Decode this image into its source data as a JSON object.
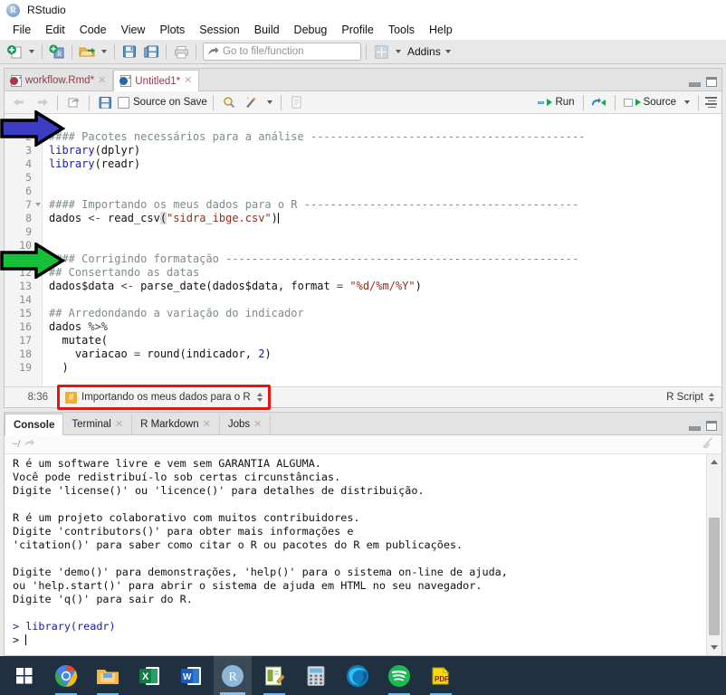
{
  "window": {
    "title": "RStudio",
    "logo_icon": "rstudio-logo-icon"
  },
  "menubar": {
    "items": [
      "File",
      "Edit",
      "Code",
      "View",
      "Plots",
      "Session",
      "Build",
      "Debug",
      "Profile",
      "Tools",
      "Help"
    ]
  },
  "toolbar": {
    "new_file_label": "new-file-icon",
    "new_project_label": "new-project-icon",
    "open_file_label": "open-file-icon",
    "save_label": "save-icon",
    "save_all_label": "save-all-icon",
    "print_label": "print-icon",
    "goto_placeholder": "Go to file/function",
    "workspace_panes_label": "workspace-panes-icon",
    "addins_label": "Addins"
  },
  "source_pane": {
    "tabs": [
      {
        "label": "workflow.Rmd*",
        "icon": "rmarkdown-doc-icon",
        "active": false,
        "closable": true
      },
      {
        "label": "Untitled1*",
        "icon": "rscript-doc-icon",
        "active": true,
        "closable": true
      }
    ],
    "editor_toolbar": {
      "back_label": "back-arrow-icon",
      "forward_label": "forward-arrow-icon",
      "popout_label": "show-in-new-window-icon",
      "save_label": "save-icon",
      "source_on_save_label": "Source on Save",
      "find_label": "find-icon",
      "magic_label": "code-tools-icon",
      "compile_report_label": "compile-report-icon",
      "run_label": "Run",
      "rerun_label": "re-run-icon",
      "source_label": "Source",
      "outline_label": "document-outline-icon"
    },
    "lines": [
      {
        "n": 1,
        "fold": false,
        "segments": []
      },
      {
        "n": 2,
        "fold": false,
        "segments": [
          {
            "t": "#### Pacotes necessários para a análise ------------------------------------------",
            "c": "cmt"
          }
        ]
      },
      {
        "n": 3,
        "fold": false,
        "segments": [
          {
            "t": "library",
            "c": "kw"
          },
          {
            "t": "(dplyr)",
            "c": "plain2"
          }
        ]
      },
      {
        "n": 4,
        "fold": false,
        "segments": [
          {
            "t": "library",
            "c": "kw"
          },
          {
            "t": "(readr)",
            "c": "plain2"
          }
        ]
      },
      {
        "n": 5,
        "fold": false,
        "segments": []
      },
      {
        "n": 6,
        "fold": false,
        "segments": []
      },
      {
        "n": 7,
        "fold": true,
        "segments": [
          {
            "t": "#### Importando os meus dados para o R ------------------------------------------",
            "c": "cmt"
          }
        ]
      },
      {
        "n": 8,
        "fold": false,
        "segments": [
          {
            "t": "dados ",
            "c": "plain2"
          },
          {
            "t": "<- ",
            "c": "op"
          },
          {
            "t": "read_csv",
            "c": "plain2"
          },
          {
            "t": "(",
            "c": "paren-hl"
          },
          {
            "t": "\"sidra_ibge.csv\"",
            "c": "str"
          },
          {
            "t": ")",
            "c": "plain2"
          },
          {
            "t": "|CARET|",
            "c": "caret"
          }
        ]
      },
      {
        "n": 9,
        "fold": false,
        "segments": []
      },
      {
        "n": 10,
        "fold": false,
        "segments": []
      },
      {
        "n": 11,
        "fold": true,
        "segments": [
          {
            "t": "#### Corrigindo formatação ------------------------------------------------------",
            "c": "cmt"
          }
        ]
      },
      {
        "n": 12,
        "fold": false,
        "segments": [
          {
            "t": "## Consertando as datas",
            "c": "cmt"
          }
        ]
      },
      {
        "n": 13,
        "fold": false,
        "segments": [
          {
            "t": "dados$data ",
            "c": "plain2"
          },
          {
            "t": "<- ",
            "c": "op"
          },
          {
            "t": "parse_date(dados$data, format ",
            "c": "plain2"
          },
          {
            "t": "= ",
            "c": "op"
          },
          {
            "t": "\"%d/%m/%Y\"",
            "c": "str"
          },
          {
            "t": ")",
            "c": "plain2"
          }
        ]
      },
      {
        "n": 14,
        "fold": false,
        "segments": []
      },
      {
        "n": 15,
        "fold": false,
        "segments": [
          {
            "t": "## Arredondando a variação do indicador",
            "c": "cmt"
          }
        ]
      },
      {
        "n": 16,
        "fold": false,
        "segments": [
          {
            "t": "dados ",
            "c": "plain2"
          },
          {
            "t": "%>%",
            "c": "op"
          }
        ]
      },
      {
        "n": 17,
        "fold": false,
        "segments": [
          {
            "t": "  mutate(",
            "c": "plain2"
          }
        ]
      },
      {
        "n": 18,
        "fold": false,
        "segments": [
          {
            "t": "    variacao ",
            "c": "plain2"
          },
          {
            "t": "= ",
            "c": "op"
          },
          {
            "t": "round(indicador, ",
            "c": "plain2"
          },
          {
            "t": "2",
            "c": "num"
          },
          {
            "t": ")",
            "c": "plain2"
          }
        ]
      },
      {
        "n": 19,
        "fold": false,
        "segments": [
          {
            "t": "  )",
            "c": "plain2"
          }
        ]
      }
    ],
    "status": {
      "cursor_position": "8:36",
      "scope_icon": "hash-section-icon",
      "scope_label": "Importando os meus dados para o R",
      "file_type": "R Script",
      "highlight_color": "#e8140f"
    }
  },
  "console_pane": {
    "tabs": [
      {
        "label": "Console",
        "active": true,
        "closable": false
      },
      {
        "label": "Terminal",
        "active": false,
        "closable": true
      },
      {
        "label": "R Markdown",
        "active": false,
        "closable": true
      },
      {
        "label": "Jobs",
        "active": false,
        "closable": true
      }
    ],
    "working_dir": "~/",
    "dir_icon": "open-in-window-icon",
    "clear_icon": "broom-icon",
    "output_lines": [
      {
        "t": "R é um software livre e vem sem GARANTIA ALGUMA.",
        "c": "plain"
      },
      {
        "t": "Você pode redistribuí-lo sob certas circunstâncias.",
        "c": "plain"
      },
      {
        "t": "Digite 'license()' ou 'licence()' para detalhes de distribuição.",
        "c": "plain"
      },
      {
        "t": "",
        "c": "plain"
      },
      {
        "t": "R é um projeto colaborativo com muitos contribuidores.",
        "c": "plain"
      },
      {
        "t": "Digite 'contributors()' para obter mais informações e",
        "c": "plain"
      },
      {
        "t": "'citation()' para saber como citar o R ou pacotes do R em publicações.",
        "c": "plain"
      },
      {
        "t": "",
        "c": "plain"
      },
      {
        "t": "Digite 'demo()' para demonstrações, 'help()' para o sistema on-line de ajuda,",
        "c": "plain"
      },
      {
        "t": "ou 'help.start()' para abrir o sistema de ajuda em HTML no seu navegador.",
        "c": "plain"
      },
      {
        "t": "Digite 'q()' para sair do R.",
        "c": "plain"
      },
      {
        "t": "",
        "c": "plain"
      },
      {
        "t": "> library(readr)",
        "c": "cblue"
      },
      {
        "t": "> ",
        "c": "plain"
      }
    ]
  },
  "annotations": [
    {
      "name": "blue-arrow",
      "color": "#3b3bc4",
      "target": "line-2-comment-header"
    },
    {
      "name": "green-arrow",
      "color": "#17c039",
      "target": "line-12-comment-header"
    }
  ],
  "taskbar": {
    "items": [
      {
        "name": "start-button-icon",
        "label": "Start"
      },
      {
        "name": "google-chrome-icon",
        "label": "Google Chrome"
      },
      {
        "name": "file-explorer-icon",
        "label": "File Explorer"
      },
      {
        "name": "excel-icon",
        "label": "Excel"
      },
      {
        "name": "word-icon",
        "label": "Word"
      },
      {
        "name": "rstudio-icon",
        "label": "RStudio"
      },
      {
        "name": "notepad-icon",
        "label": "Notepad"
      },
      {
        "name": "calculator-icon",
        "label": "Calculator"
      },
      {
        "name": "edge-icon",
        "label": "Microsoft Edge"
      },
      {
        "name": "spotify-icon",
        "label": "Spotify"
      },
      {
        "name": "pdf-icon",
        "label": "PDF Reader"
      }
    ]
  }
}
